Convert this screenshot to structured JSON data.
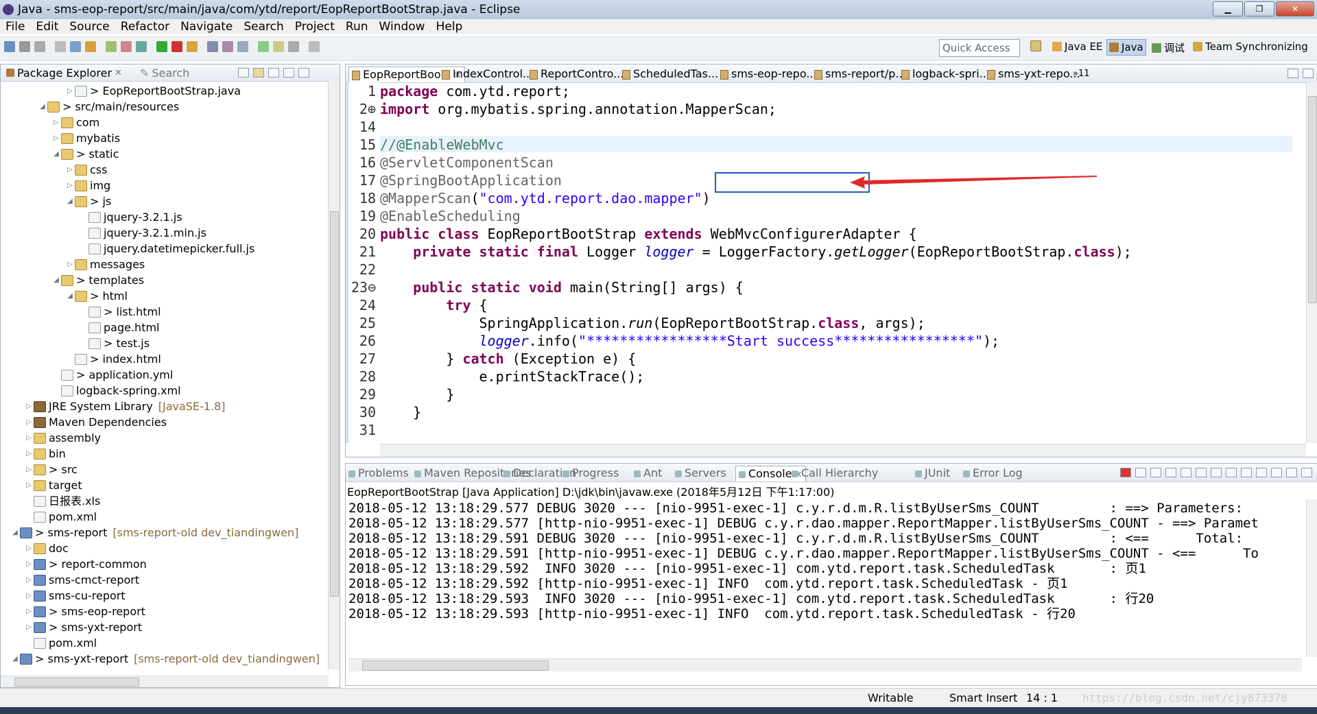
{
  "window": {
    "title": "Java - sms-eop-report/src/main/java/com/ytd/report/EopReportBootStrap.java - Eclipse"
  },
  "menu": [
    "File",
    "Edit",
    "Source",
    "Refactor",
    "Navigate",
    "Search",
    "Project",
    "Run",
    "Window",
    "Help"
  ],
  "toolbar": {
    "quick_access_placeholder": "Quick Access",
    "perspectives": [
      "Java EE",
      "Java",
      "调试",
      "Team Synchronizing"
    ]
  },
  "package_explorer": {
    "title": "Package Explorer",
    "search_label": "Search",
    "items": [
      {
        "label": "> EopReportBootStrap.java",
        "depth": 4,
        "kind": "file",
        "twisty": "closed"
      },
      {
        "label": "> src/main/resources",
        "depth": 2,
        "kind": "fold",
        "twisty": "open"
      },
      {
        "label": "com",
        "depth": 3,
        "kind": "fold",
        "twisty": "closed"
      },
      {
        "label": "mybatis",
        "depth": 3,
        "kind": "fold",
        "twisty": "closed"
      },
      {
        "label": "> static",
        "depth": 3,
        "kind": "fold",
        "twisty": "open"
      },
      {
        "label": "css",
        "depth": 4,
        "kind": "fold",
        "twisty": "closed"
      },
      {
        "label": "img",
        "depth": 4,
        "kind": "fold",
        "twisty": "closed"
      },
      {
        "label": "> js",
        "depth": 4,
        "kind": "fold",
        "twisty": "open"
      },
      {
        "label": "jquery-3.2.1.js",
        "depth": 5,
        "kind": "file",
        "twisty": ""
      },
      {
        "label": "jquery-3.2.1.min.js",
        "depth": 5,
        "kind": "file",
        "twisty": ""
      },
      {
        "label": "jquery.datetimepicker.full.js",
        "depth": 5,
        "kind": "file",
        "twisty": ""
      },
      {
        "label": "messages",
        "depth": 4,
        "kind": "fold",
        "twisty": "closed"
      },
      {
        "label": "> templates",
        "depth": 3,
        "kind": "fold",
        "twisty": "open"
      },
      {
        "label": "> html",
        "depth": 4,
        "kind": "fold",
        "twisty": "open"
      },
      {
        "label": "> list.html",
        "depth": 5,
        "kind": "file",
        "twisty": ""
      },
      {
        "label": "page.html",
        "depth": 5,
        "kind": "file",
        "twisty": ""
      },
      {
        "label": "> test.js",
        "depth": 5,
        "kind": "file",
        "twisty": ""
      },
      {
        "label": "> index.html",
        "depth": 4,
        "kind": "file",
        "twisty": ""
      },
      {
        "label": "> application.yml",
        "depth": 3,
        "kind": "file",
        "twisty": ""
      },
      {
        "label": "logback-spring.xml",
        "depth": 3,
        "kind": "file",
        "twisty": ""
      },
      {
        "label": "JRE System Library",
        "deco": "[JavaSE-1.8]",
        "depth": 1,
        "kind": "jar",
        "twisty": "closed"
      },
      {
        "label": "Maven Dependencies",
        "depth": 1,
        "kind": "jar",
        "twisty": "closed"
      },
      {
        "label": "assembly",
        "depth": 1,
        "kind": "fold",
        "twisty": "closed"
      },
      {
        "label": "bin",
        "depth": 1,
        "kind": "fold",
        "twisty": "closed"
      },
      {
        "label": "> src",
        "depth": 1,
        "kind": "fold",
        "twisty": "closed"
      },
      {
        "label": "target",
        "depth": 1,
        "kind": "fold",
        "twisty": "closed"
      },
      {
        "label": "日报表.xls",
        "depth": 1,
        "kind": "file",
        "twisty": ""
      },
      {
        "label": "pom.xml",
        "depth": 1,
        "kind": "file",
        "twisty": ""
      },
      {
        "label": "> sms-report",
        "deco": "[sms-report-old dev_tiandingwen]",
        "depth": 0,
        "kind": "proj",
        "twisty": "open"
      },
      {
        "label": "doc",
        "depth": 1,
        "kind": "fold",
        "twisty": "closed"
      },
      {
        "label": "> report-common",
        "depth": 1,
        "kind": "proj",
        "twisty": "closed"
      },
      {
        "label": "sms-cmct-report",
        "depth": 1,
        "kind": "proj",
        "twisty": "closed"
      },
      {
        "label": "sms-cu-report",
        "depth": 1,
        "kind": "proj",
        "twisty": "closed"
      },
      {
        "label": "> sms-eop-report",
        "depth": 1,
        "kind": "proj",
        "twisty": "closed"
      },
      {
        "label": "> sms-yxt-report",
        "depth": 1,
        "kind": "proj",
        "twisty": "closed"
      },
      {
        "label": "pom.xml",
        "depth": 1,
        "kind": "file",
        "twisty": ""
      },
      {
        "label": "> sms-yxt-report",
        "deco": "[sms-report-old dev_tiandingwen]",
        "depth": 0,
        "kind": "proj",
        "twisty": "open"
      }
    ]
  },
  "editor": {
    "tabs": [
      "EopReportBoo...",
      "IndexControl...",
      "ReportContro...",
      "ScheduledTas...",
      "sms-eop-repo...",
      "sms-report/p...",
      "logback-spri...",
      "sms-yxt-repo..."
    ],
    "tab_overflow": "»11",
    "line_numbers": [
      "1",
      "2⊕",
      "14",
      "15",
      "16",
      "17",
      "18",
      "19",
      "20",
      "21",
      "22",
      "23⊖",
      "24",
      "25",
      "26",
      "27",
      "28",
      "29",
      "30",
      "31"
    ],
    "lines": [
      [
        {
          "t": "package",
          "c": "kw"
        },
        {
          "t": " com.ytd.report;"
        }
      ],
      [
        {
          "t": "import",
          "c": "kw"
        },
        {
          "t": " org.mybatis.spring.annotation.MapperScan;"
        }
      ],
      [
        {
          "t": ""
        }
      ],
      [
        {
          "t": "//@EnableWebMvc",
          "c": "cmt"
        }
      ],
      [
        {
          "t": "@ServletComponentScan",
          "c": "ann"
        }
      ],
      [
        {
          "t": "@SpringBootApplication",
          "c": "ann"
        }
      ],
      [
        {
          "t": "@MapperScan",
          "c": "ann"
        },
        {
          "t": "("
        },
        {
          "t": "\"com.ytd.report.dao.mapper\"",
          "c": "str"
        },
        {
          "t": ")"
        }
      ],
      [
        {
          "t": "@EnableScheduling",
          "c": "ann"
        }
      ],
      [
        {
          "t": "public class",
          "c": "kw"
        },
        {
          "t": " EopReportBootStrap "
        },
        {
          "t": "extends",
          "c": "kw"
        },
        {
          "t": " WebMvcConfigurerAdapter {"
        }
      ],
      [
        {
          "t": "    "
        },
        {
          "t": "private static final",
          "c": "kw"
        },
        {
          "t": " Logger "
        },
        {
          "t": "logger",
          "c": "fld"
        },
        {
          "t": " = LoggerFactory."
        },
        {
          "t": "getLogger",
          "c": "ital"
        },
        {
          "t": "(EopReportBootStrap."
        },
        {
          "t": "class",
          "c": "kw"
        },
        {
          "t": ");"
        }
      ],
      [
        {
          "t": ""
        }
      ],
      [
        {
          "t": "    "
        },
        {
          "t": "public static void",
          "c": "kw"
        },
        {
          "t": " main(String[] args) {"
        }
      ],
      [
        {
          "t": "        "
        },
        {
          "t": "try",
          "c": "kw"
        },
        {
          "t": " {"
        }
      ],
      [
        {
          "t": "            SpringApplication."
        },
        {
          "t": "run",
          "c": "ital"
        },
        {
          "t": "(EopReportBootStrap."
        },
        {
          "t": "class",
          "c": "kw"
        },
        {
          "t": ", args);"
        }
      ],
      [
        {
          "t": "            "
        },
        {
          "t": "logger",
          "c": "fld"
        },
        {
          "t": ".info("
        },
        {
          "t": "\"*****************Start success*****************\"",
          "c": "str"
        },
        {
          "t": ");"
        }
      ],
      [
        {
          "t": "        } "
        },
        {
          "t": "catch",
          "c": "kw"
        },
        {
          "t": " (Exception e) {"
        }
      ],
      [
        {
          "t": "            e.printStackTrace();"
        }
      ],
      [
        {
          "t": "        }"
        }
      ],
      [
        {
          "t": "    }"
        }
      ],
      [
        {
          "t": ""
        }
      ]
    ]
  },
  "console": {
    "tabs": [
      "Problems",
      "Maven Repositories",
      "Declaration",
      "Progress",
      "Ant",
      "Servers",
      "Console",
      "Call Hierarchy",
      "JUnit",
      "Error Log"
    ],
    "active_tab": "Console",
    "run_title": "EopReportBootStrap [Java Application] D:\\jdk\\bin\\javaw.exe (2018年5月12日 下午1:17:00)",
    "lines": [
      "2018-05-12 13:18:29.577 DEBUG 3020 --- [nio-9951-exec-1] c.y.r.d.m.R.listByUserSms_COUNT         : ==> Parameters:",
      "2018-05-12 13:18:29.577 [http-nio-9951-exec-1] DEBUG c.y.r.dao.mapper.ReportMapper.listByUserSms_COUNT - ==> Paramet",
      "2018-05-12 13:18:29.591 DEBUG 3020 --- [nio-9951-exec-1] c.y.r.d.m.R.listByUserSms_COUNT         : <==      Total:",
      "2018-05-12 13:18:29.591 [http-nio-9951-exec-1] DEBUG c.y.r.dao.mapper.ReportMapper.listByUserSms_COUNT - <==      To",
      "2018-05-12 13:18:29.592  INFO 3020 --- [nio-9951-exec-1] com.ytd.report.task.ScheduledTask       : 页1",
      "2018-05-12 13:18:29.592 [http-nio-9951-exec-1] INFO  com.ytd.report.task.ScheduledTask - 页1",
      "2018-05-12 13:18:29.593  INFO 3020 --- [nio-9951-exec-1] com.ytd.report.task.ScheduledTask       : 行20",
      "2018-05-12 13:18:29.593 [http-nio-9951-exec-1] INFO  com.ytd.report.task.ScheduledTask - 行20"
    ]
  },
  "status": {
    "writable": "Writable",
    "insert_mode": "Smart Insert",
    "position": "14 : 1",
    "watermark": "https://blog.csdn.net/cjy873378"
  }
}
